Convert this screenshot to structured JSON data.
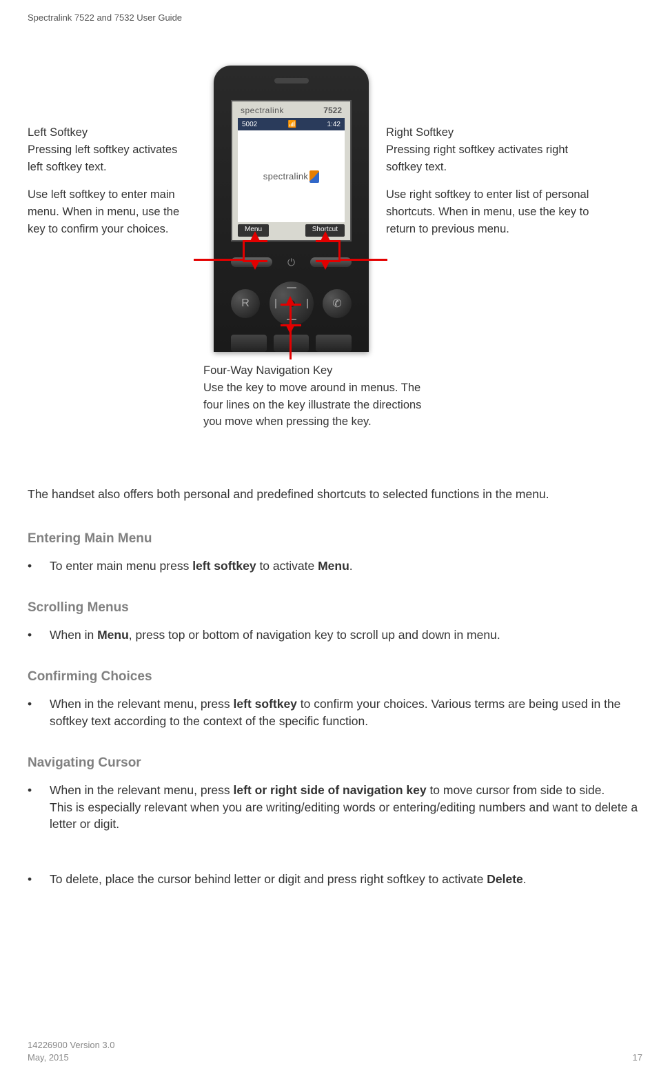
{
  "header": {
    "title": "Spectralink 7522 and 7532 User Guide"
  },
  "phone": {
    "brand": "spectralink",
    "model": "7522",
    "status_left": "5002",
    "status_time": "1:42",
    "logo_text": "spectralink",
    "softkey_left": "Menu",
    "softkey_right": "Shortcut"
  },
  "callouts": {
    "left_title": "Left Softkey",
    "left_desc1": "Pressing left softkey activates left softkey text.",
    "left_desc2": "Use left softkey to enter main menu. When in menu, use the key to confirm your choices.",
    "right_title": "Right Softkey",
    "right_desc1": "Pressing right softkey activates right softkey text.",
    "right_desc2": "Use right softkey to enter list of personal shortcuts. When in menu, use the key to return to previous menu.",
    "nav_title": "Four-Way Navigation Key",
    "nav_desc": "Use the key to move around in menus. The four lines on the key illustrate the directions you move when pressing the key."
  },
  "body": {
    "intro": "The handset also offers both personal and predefined shortcuts to selected functions in the menu.",
    "sections": {
      "entering": {
        "heading": "Entering Main Menu",
        "bullet_pre": "To enter main menu press ",
        "bullet_bold1": "left softkey",
        "bullet_mid": " to activate ",
        "bullet_bold2": "Menu",
        "bullet_suffix": "."
      },
      "scrolling": {
        "heading": "Scrolling Menus",
        "bullet_pre": "When in ",
        "bullet_bold": "Menu",
        "bullet_suffix": ", press top or bottom of navigation key to scroll up and down in menu."
      },
      "confirming": {
        "heading": "Confirming Choices",
        "bullet_pre": "When in the relevant menu, press ",
        "bullet_bold": "left softkey",
        "bullet_suffix": " to confirm your choices. Various terms are being used in the softkey text according to the context of the specific function."
      },
      "navigating": {
        "heading": "Navigating Cursor",
        "bullet1_pre": "When in the relevant menu, press ",
        "bullet1_bold": "left or right side of navigation key",
        "bullet1_suffix": " to move cursor from side to side.",
        "bullet1_line2": "This is especially relevant when you are writing/editing words or entering/editing numbers and want to delete a letter or digit.",
        "bullet2_pre": "To delete, place the cursor behind letter or digit and press right softkey to activate ",
        "bullet2_bold": "Delete",
        "bullet2_suffix": "."
      }
    }
  },
  "footer": {
    "version": "14226900 Version 3.0",
    "date": "May, 2015",
    "page": "17"
  }
}
